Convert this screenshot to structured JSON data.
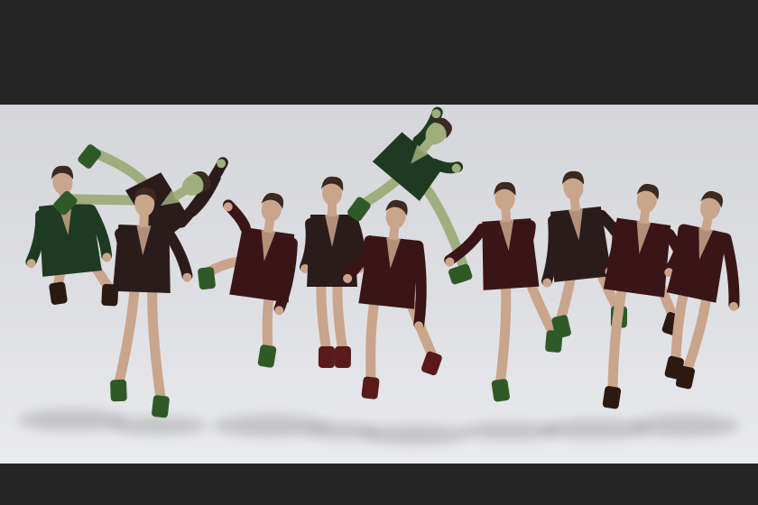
{
  "image": {
    "subject": "photo-montage",
    "colors": {
      "letterbox": "#252525",
      "backdrop": "#dcdde1",
      "jacket_green": "#1f3a22",
      "jacket_maroon": "#3a1518",
      "jacket_dark": "#2b1c1c",
      "skin": "#c9a58c",
      "skin_green": "#9fae7c",
      "boot_dark": "#2a1a12",
      "boot_green": "#2f5a28",
      "boot_maroon": "#5a1a1a",
      "hair": "#3a2a22",
      "shadow": "#9a9a9c"
    },
    "figures": [
      {
        "id": "jumper-1",
        "jacket": "jacket_green",
        "skin": "skin",
        "boots": "boot_dark"
      },
      {
        "id": "jumper-2",
        "jacket": "jacket_dark",
        "skin": "skin_green",
        "boots": "boot_green"
      },
      {
        "id": "jumper-3",
        "jacket": "jacket_dark",
        "skin": "skin",
        "boots": "boot_green"
      },
      {
        "id": "jumper-4",
        "jacket": "jacket_maroon",
        "skin": "skin",
        "boots": "boot_green"
      },
      {
        "id": "jumper-5",
        "jacket": "jacket_dark",
        "skin": "skin",
        "boots": "boot_maroon"
      },
      {
        "id": "jumper-6",
        "jacket": "jacket_maroon",
        "skin": "skin",
        "boots": "boot_maroon"
      },
      {
        "id": "jumper-7",
        "jacket": "jacket_green",
        "skin": "skin_green",
        "boots": "boot_green"
      },
      {
        "id": "jumper-8",
        "jacket": "jacket_maroon",
        "skin": "skin",
        "boots": "boot_green"
      },
      {
        "id": "jumper-9",
        "jacket": "jacket_dark",
        "skin": "skin",
        "boots": "boot_green"
      },
      {
        "id": "jumper-10",
        "jacket": "jacket_maroon",
        "skin": "skin",
        "boots": "boot_dark"
      },
      {
        "id": "jumper-11",
        "jacket": "jacket_maroon",
        "skin": "skin",
        "boots": "boot_dark"
      }
    ]
  }
}
